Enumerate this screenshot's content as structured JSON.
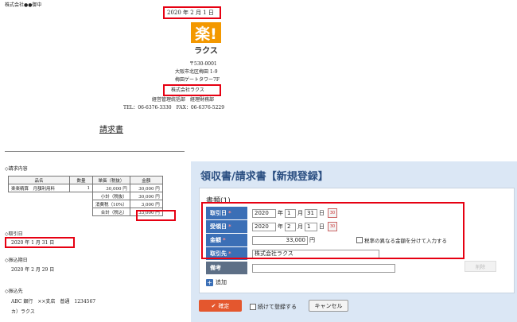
{
  "doc": {
    "addressee": "株式会社●●御中",
    "date": "2020 年 2 月 1 日",
    "logo_mark": "楽!",
    "logo_text": "ラクス",
    "postal": "〒530-0001",
    "address1": "大阪市北区梅田 1-9",
    "address2": "梅田ゲートタワー7F",
    "company": "株式会社ラクス",
    "department": "経営管理統括部　経理財務部",
    "phone": "TEL：06-6376-3330　FAX：06-6376-5229",
    "title": "請求書",
    "section_items": "◇請求内容",
    "table_headers": [
      "品名",
      "数量",
      "単価（税抜）",
      "金額"
    ],
    "table_row": [
      "楽楽精算　月額利用料",
      "1",
      "30,000 円",
      "30,000 円"
    ],
    "subtotal_label": "小計（税抜）",
    "subtotal_value": "30,000 円",
    "tax_label": "消費税（10%）",
    "tax_value": "3,000 円",
    "total_label": "合計（税込）",
    "total_value": "33,000 円",
    "section_transaction_date": "◇取引日",
    "transaction_date": "2020 年 1 月 31 日",
    "section_due_date": "◇振込期日",
    "due_date": "2020 年 2 月 29 日",
    "section_bank": "◇振込先",
    "bank": "ABC 銀行　××支店　普通　1234567",
    "account_name": "カ）ラクス"
  },
  "form": {
    "title": "領収書/請求書【新規登録】",
    "card_title": "書類(1)",
    "transaction_date_label": "取引日",
    "received_date_label": "受領日",
    "amount_label": "金額",
    "payee_label": "取引先",
    "memo_label": "備考",
    "required_mark": "*",
    "t_year": "2020",
    "t_month": "1",
    "t_day": "31",
    "r_year": "2020",
    "r_month": "2",
    "r_day": "1",
    "year_unit": "年",
    "month_unit": "月",
    "day_unit": "日",
    "amount": "33,000",
    "currency": "円",
    "tax_split_label": "税率の異なる金額を分けて入力する",
    "delete_label": "削除",
    "payee": "株式会社ラクス",
    "memo": "",
    "add_label": "追加",
    "confirm_label": "確定",
    "continue_label": "続けて登録する",
    "cancel_label": "キャンセル",
    "calendar_glyph": "30"
  },
  "colors": {
    "highlight": "#e60012",
    "panel_bg": "#dbe7f5",
    "label_blue": "#3b6fb6",
    "confirm": "#e4572e",
    "logo": "#f39800"
  }
}
